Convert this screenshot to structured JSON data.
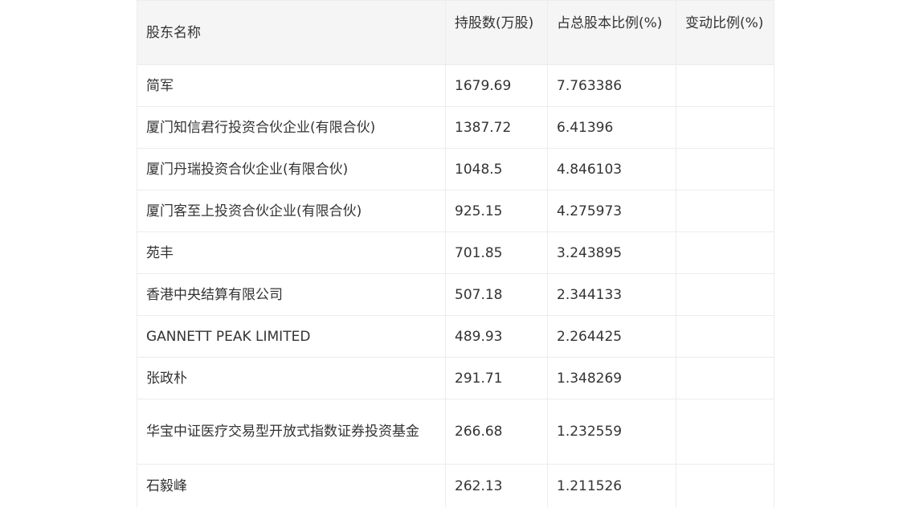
{
  "table": {
    "headers": [
      "股东名称",
      "持股数(万股)",
      "占总股本比例(%)",
      "变动比例(%)"
    ],
    "rows": [
      {
        "name": "简军",
        "shares": "1679.69",
        "ratio": "7.763386",
        "change": ""
      },
      {
        "name": "厦门知信君行投资合伙企业(有限合伙)",
        "shares": "1387.72",
        "ratio": "6.41396",
        "change": ""
      },
      {
        "name": "厦门丹瑞投资合伙企业(有限合伙)",
        "shares": "1048.5",
        "ratio": "4.846103",
        "change": ""
      },
      {
        "name": "厦门客至上投资合伙企业(有限合伙)",
        "shares": "925.15",
        "ratio": "4.275973",
        "change": ""
      },
      {
        "name": "苑丰",
        "shares": "701.85",
        "ratio": "3.243895",
        "change": ""
      },
      {
        "name": "香港中央结算有限公司",
        "shares": "507.18",
        "ratio": "2.344133",
        "change": ""
      },
      {
        "name": "GANNETT PEAK LIMITED",
        "shares": "489.93",
        "ratio": "2.264425",
        "change": ""
      },
      {
        "name": "张政朴",
        "shares": "291.71",
        "ratio": "1.348269",
        "change": ""
      },
      {
        "name": "华宝中证医疗交易型开放式指数证券投资基金",
        "shares": "266.68",
        "ratio": "1.232559",
        "change": ""
      },
      {
        "name": "石毅峰",
        "shares": "262.13",
        "ratio": "1.211526",
        "change": ""
      }
    ]
  }
}
